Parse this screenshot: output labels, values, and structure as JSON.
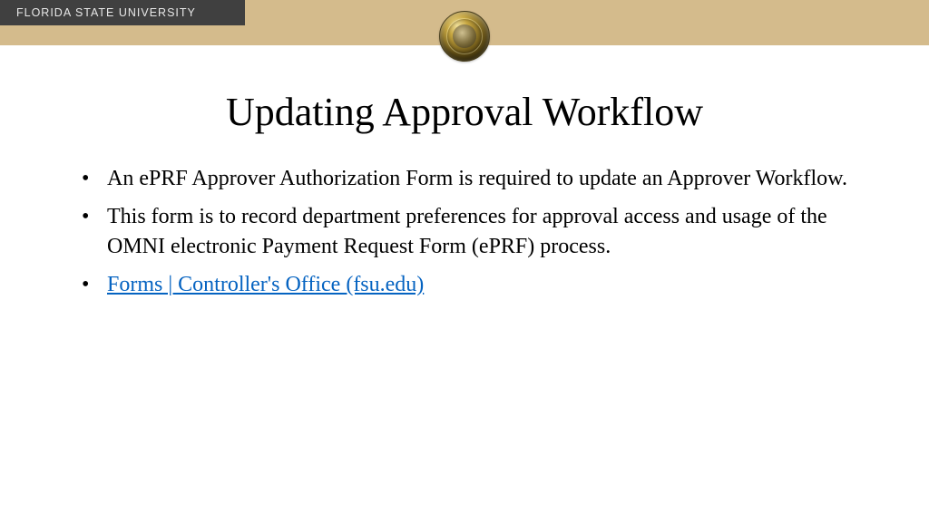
{
  "header": {
    "org_name": "FLORIDA STATE UNIVERSITY"
  },
  "title": "Updating Approval Workflow",
  "bullets": [
    "An ePRF Approver Authorization Form is required to update an Approver Workflow.",
    "This form is to record department preferences for approval access and usage of the OMNI electronic Payment Request Form (ePRF) process."
  ],
  "link": {
    "label": "Forms | Controller's Office (fsu.edu)"
  }
}
